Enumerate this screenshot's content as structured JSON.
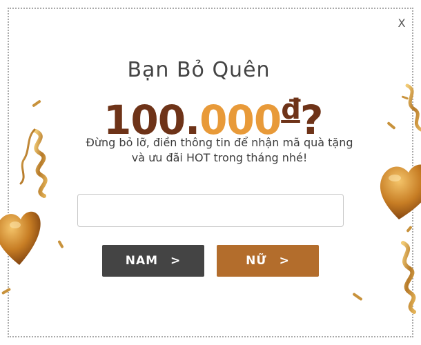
{
  "popup": {
    "close_label": "X",
    "headline": "Bạn Bỏ Quên",
    "amount_part1": "100.",
    "amount_part2": "000",
    "currency_symbol": "đ",
    "question_mark": "?",
    "description_line1": "Đừng bỏ lỡ, điền thông tin để nhận mã quà tặng",
    "description_line2": "và ưu đãi HOT trong tháng nhé!",
    "input": {
      "value": "",
      "placeholder": ""
    },
    "buttons": {
      "male_label": "NAM",
      "female_label": "NỮ",
      "chevron": ">"
    }
  },
  "colors": {
    "accent_dark": "#6e3318",
    "accent_light": "#e89a39",
    "button_male": "#444444",
    "button_female": "#b36d2c",
    "gold": "#c08a30"
  },
  "decorations": [
    "gold-heart-icon",
    "gold-ribbon-icon",
    "confetti-icon"
  ]
}
